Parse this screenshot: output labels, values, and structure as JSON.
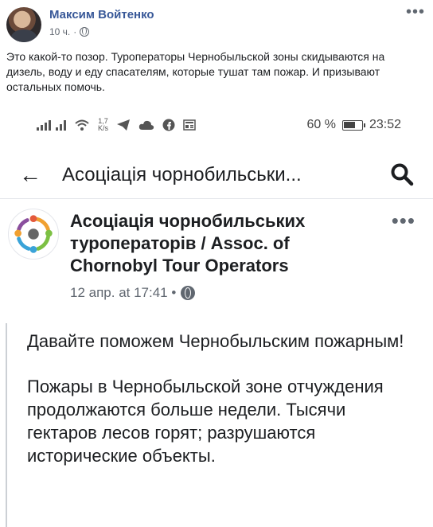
{
  "post": {
    "author": "Максим Войтенко",
    "time": "10 ч.",
    "more": "•••",
    "text": "Это какой-то позор. Туроператоры Чернобыльской зоны скидываются на дизель, воду и еду спасателям, которые тушат там пожар. И призывают остальных помочь."
  },
  "phone": {
    "status": {
      "speed_value": "1,7",
      "speed_unit": "K/s",
      "battery": "60 %",
      "clock": "23:52"
    },
    "search": {
      "back": "←",
      "title": "Асоціація чорнобильськи..."
    },
    "page_post": {
      "page_name": "Асоціація чорнобильських туроператорів / Assoc. of Chornobyl Tour Operators",
      "date": "12 апр. at 17:41 •",
      "more": "•••",
      "paragraph_1": "Давайте поможем Чернобыльским пожарным!",
      "paragraph_2": "Пожары в Чернобыльской зоне отчуждения продолжаются больше недели. Тысячи гектаров лесов горят; разрушаются исторические объекты."
    }
  },
  "colors": {
    "author_link": "#385898",
    "logo_green": "#7cc043",
    "logo_orange": "#f0a030",
    "logo_blue": "#3aa3d8",
    "logo_purple": "#8a4f9e",
    "logo_red": "#e45a3c"
  },
  "icons": [
    "globe-icon",
    "signal-icon",
    "wifi-icon",
    "telegram-icon",
    "cloud-icon",
    "facebook-icon",
    "news-icon",
    "battery-icon",
    "back-arrow-icon",
    "search-icon",
    "more-icon"
  ]
}
